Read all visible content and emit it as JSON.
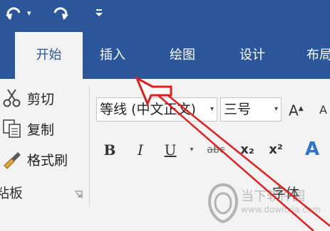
{
  "quick_access": {
    "undo_icon": "undo-icon",
    "redo_icon": "redo-icon",
    "dropdown_glyph": "▾",
    "customize_icon": "customize-qat-icon"
  },
  "tabs": [
    {
      "label": "开始",
      "active": true
    },
    {
      "label": "插入",
      "active": false
    },
    {
      "label": "绘图",
      "active": false
    },
    {
      "label": "设计",
      "active": false
    },
    {
      "label": "布局",
      "active": false
    }
  ],
  "clipboard": {
    "cut_label": "剪切",
    "copy_label": "复制",
    "format_painter_label": "格式刷",
    "group_label": "粘板"
  },
  "font": {
    "font_name_value": "等线 (中文正文)",
    "font_size_value": "三号",
    "bold": "B",
    "italic": "I",
    "underline": "U",
    "strikethrough": "abc",
    "subscript": "x₂",
    "superscript": "x²",
    "grow": "A",
    "shrink": "A",
    "text_effects": "A",
    "group_label": "字体"
  },
  "watermark": {
    "name": "当下软件园",
    "url": "www.downxia.com"
  },
  "colors": {
    "brand_blue": "#2b579a",
    "ribbon_bg": "#f3f3f3",
    "annotation_red": "#e0201c",
    "effects_blue": "#2e75c8"
  }
}
